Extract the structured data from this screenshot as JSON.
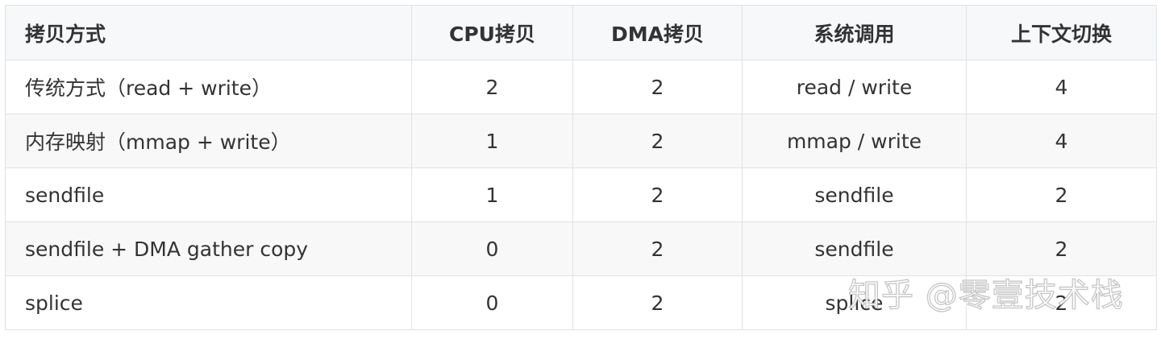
{
  "table": {
    "headers": [
      "拷贝方式",
      "CPU拷贝",
      "DMA拷贝",
      "系统调用",
      "上下文切换"
    ],
    "rows": [
      [
        "传统方式（read + write）",
        "2",
        "2",
        "read / write",
        "4"
      ],
      [
        "内存映射（mmap + write）",
        "1",
        "2",
        "mmap / write",
        "4"
      ],
      [
        "sendfile",
        "1",
        "2",
        "sendfile",
        "2"
      ],
      [
        "sendfile + DMA gather copy",
        "0",
        "2",
        "sendfile",
        "2"
      ],
      [
        "splice",
        "0",
        "2",
        "splice",
        "2"
      ]
    ]
  },
  "watermark": {
    "text": "知乎 @零壹技术栈"
  },
  "colors": {
    "header_bg": "#f6f8fa",
    "border": "#dfe2e5",
    "stripe_bg": "#f8f8f8",
    "text": "#333333"
  }
}
